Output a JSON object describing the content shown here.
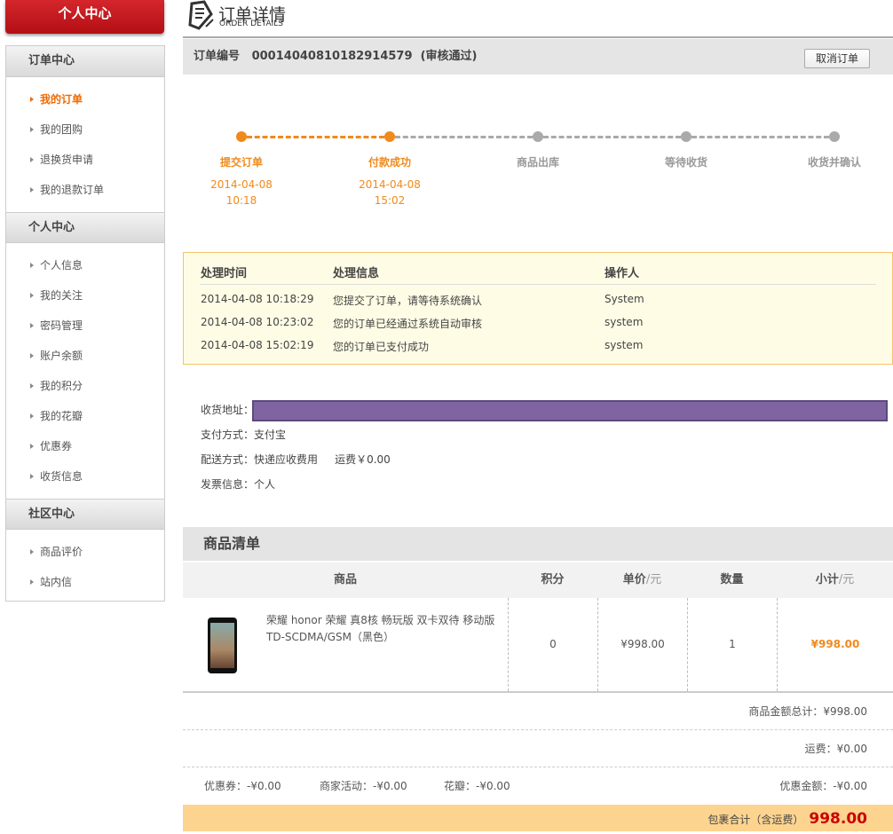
{
  "sidebar": {
    "header": "个人中心",
    "sections": [
      {
        "title": "订单中心",
        "items": [
          "我的订单",
          "我的团购",
          "退换货申请",
          "我的退款订单"
        ]
      },
      {
        "title": "个人中心",
        "items": [
          "个人信息",
          "我的关注",
          "密码管理",
          "账户余额",
          "我的积分",
          "我的花瓣",
          "优惠券",
          "收货信息"
        ]
      },
      {
        "title": "社区中心",
        "items": [
          "商品评价",
          "站内信"
        ]
      }
    ],
    "active": "我的订单"
  },
  "header": {
    "title": "订单详情",
    "subtitle": "ORDER DETAILS"
  },
  "order": {
    "label": "订单编号",
    "number": "00014040810182914579",
    "status": "(审核通过)",
    "cancel_label": "取消订单"
  },
  "progress": [
    {
      "label": "提交订单",
      "date": "2014-04-08",
      "time": "10:18",
      "done": true
    },
    {
      "label": "付款成功",
      "date": "2014-04-08",
      "time": "15:02",
      "done": true
    },
    {
      "label": "商品出库",
      "date": "",
      "time": "",
      "done": false
    },
    {
      "label": "等待收货",
      "date": "",
      "time": "",
      "done": false
    },
    {
      "label": "收货并确认",
      "date": "",
      "time": "",
      "done": false
    }
  ],
  "log": {
    "headers": [
      "处理时间",
      "处理信息",
      "操作人"
    ],
    "rows": [
      [
        "2014-04-08 10:18:29",
        "您提交了订单，请等待系统确认",
        "System"
      ],
      [
        "2014-04-08 10:23:02",
        "您的订单已经通过系统自动审核",
        "system"
      ],
      [
        "2014-04-08 15:02:19",
        "您的订单已支付成功",
        "system"
      ]
    ]
  },
  "info": {
    "address_label": "收货地址：",
    "payment": "支付方式：支付宝",
    "delivery": "配送方式：快递应收费用",
    "shipping_fee": "运费￥0.00",
    "invoice": "发票信息：个人"
  },
  "products": {
    "title": "商品清单",
    "headers": {
      "product": "商品",
      "points": "积分",
      "price": "单价",
      "price_unit": "/元",
      "qty": "数量",
      "subtotal": "小计",
      "subtotal_unit": "/元"
    },
    "items": [
      {
        "name": "荣耀 honor 荣耀 真8核 畅玩版 双卡双待 移动版 TD-SCDMA/GSM（黑色）",
        "points": "0",
        "price": "¥998.00",
        "qty": "1",
        "subtotal": "¥998.00"
      }
    ]
  },
  "summary": {
    "goods_total": "商品金额总计：¥998.00",
    "shipping": "运费：¥0.00",
    "coupon": "优惠券：-¥0.00",
    "merchant": "商家活动：-¥0.00",
    "petals": "花瓣：-¥0.00",
    "discount": "优惠金额：-¥0.00",
    "total_label": "包裹合计（含运费）",
    "total": "998.00"
  },
  "colors": {
    "accent": "#f08a1c",
    "brand_red": "#c4161c",
    "total_red": "#cc0000"
  }
}
